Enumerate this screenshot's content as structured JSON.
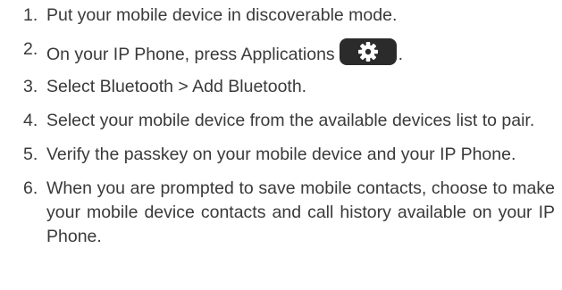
{
  "steps": [
    {
      "num": "1.",
      "text": "Put your mobile device in discoverable mode."
    },
    {
      "num": "2.",
      "text": "On your IP Phone, press Applications",
      "icon": "gear-icon",
      "trail": "."
    },
    {
      "num": "3.",
      "text": "Select Bluetooth > Add Bluetooth."
    },
    {
      "num": "4.",
      "text": "Select your mobile device from the available devices list to pair."
    },
    {
      "num": "5.",
      "text": "Verify the passkey on your mobile device and your IP Phone."
    },
    {
      "num": "6.",
      "text": "When you are prompted to save mobile contacts, choose to make your mobile device contacts and call history available on your IP Phone."
    }
  ],
  "colors": {
    "text": "#3a3a3a",
    "button_bg": "#2b2b2b",
    "icon": "#ffffff"
  }
}
